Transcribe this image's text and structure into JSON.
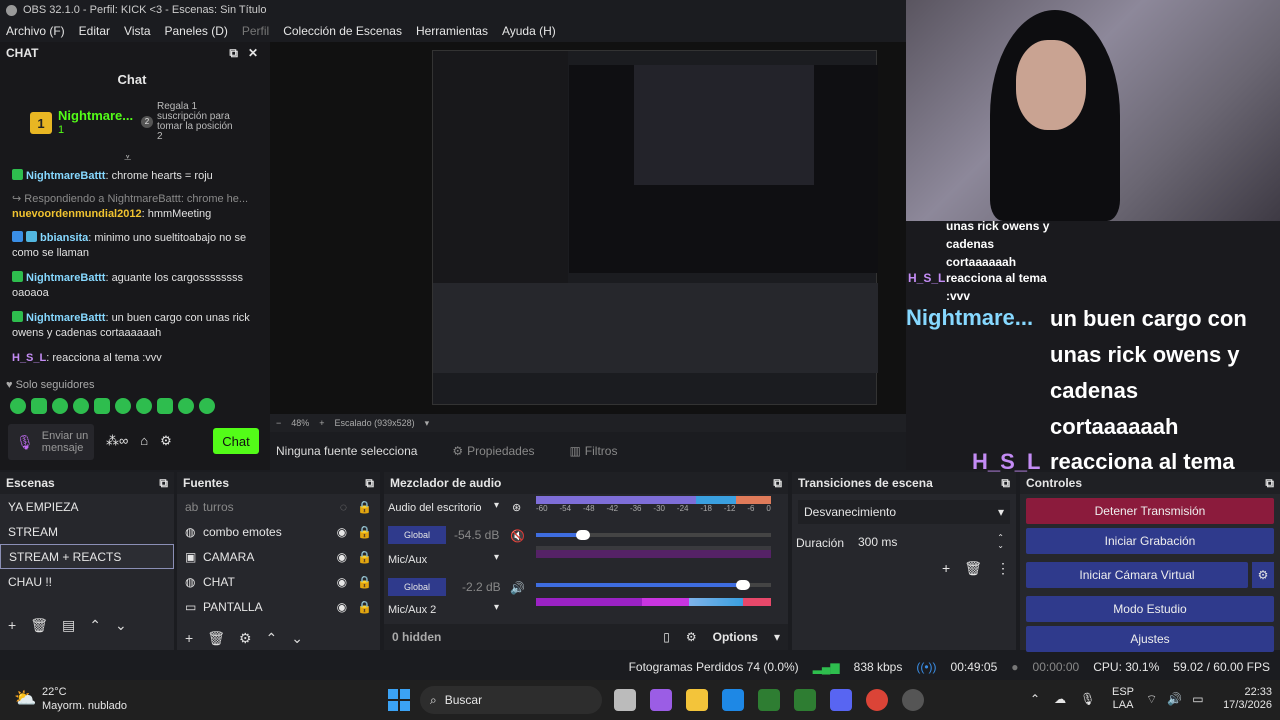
{
  "window": {
    "title": "OBS 32.1.0 - Perfil: KICK <3 - Escenas: Sin Título"
  },
  "menu": {
    "items": [
      "Archivo (F)",
      "Editar",
      "Vista",
      "Paneles (D)",
      "Perfil",
      "Colección de Escenas",
      "Herramientas",
      "Ayuda (H)"
    ]
  },
  "chat": {
    "panel_title": "CHAT",
    "title": "Chat",
    "pinned": {
      "rank": "1",
      "name": "Nightmare...",
      "count": "1",
      "gift_text": "Regala 1 suscripción para tomar la posición 2",
      "gift_rank": "2"
    },
    "messages": [
      {
        "name": "NightmareBattt",
        "text": ": chrome hearts = roju"
      },
      {
        "reply": "Respondiendo a NightmareBattt: chrome he...",
        "name": "nuevoordenmundial2012",
        "text": ": hmmMeeting"
      },
      {
        "name": "bbiansita",
        "text": ": minimo uno sueltitoabajo no se como se llaman"
      },
      {
        "name": "NightmareBattt",
        "text": ": aguante los cargossssssss oaoaoa"
      },
      {
        "name": "NightmareBattt",
        "text": ": un buen cargo con unas rick owens y cadenas cortaaaaaah"
      },
      {
        "name": "H_S_L",
        "text": ": reacciona al tema :vvv"
      }
    ],
    "followers_only": "Solo seguidores",
    "send_placeholder": "Enviar un mensaje",
    "chat_button": "Chat"
  },
  "overlay": {
    "lines_top": [
      "unas rick owens y",
      "cadenas",
      "cortaaaaaah"
    ],
    "hsl_small": "H_S_L",
    "hsl_small_text": "reacciona al tema",
    "hsl_small_text2": ":vvv",
    "name_big": "Nightmare...",
    "big_lines": [
      "un buen cargo con",
      "unas rick owens y",
      "cadenas",
      "cortaaaaaah"
    ],
    "hsl_big": "H_S_L",
    "hsl_big_text": "reacciona al tema",
    "hsl_big_text2": ":vvv"
  },
  "preview": {
    "zoom": "48%",
    "scale": "Escalado (939x528)"
  },
  "source_bar": {
    "no_source": "Ninguna fuente selecciona",
    "properties": "Propiedades",
    "filters": "Filtros"
  },
  "scenes": {
    "title": "Escenas",
    "items": [
      "YA EMPIEZA",
      "STREAM",
      "STREAM + REACTS",
      "CHAU !!"
    ],
    "selected": "STREAM + REACTS"
  },
  "sources": {
    "title": "Fuentes",
    "items": [
      "turros",
      "combo emotes",
      "CAMARA",
      "CHAT",
      "PANTALLA"
    ]
  },
  "mixer": {
    "title": "Mezclador de audio",
    "channels": [
      {
        "name": "Audio del escritorio",
        "tag": "Global",
        "db": "-54.5 dB",
        "level": 0.2
      },
      {
        "name": "Mic/Aux",
        "tag": "Global",
        "db": "-2.2 dB",
        "level": 0.88
      },
      {
        "name": "Mic/Aux 2"
      }
    ],
    "scale": [
      "-60",
      "-54",
      "-48",
      "-42",
      "-36",
      "-30",
      "-24",
      "-18",
      "-12",
      "-6",
      "0"
    ],
    "hidden": "0 hidden",
    "options": "Options"
  },
  "transitions": {
    "title": "Transiciones de escena",
    "selected": "Desvanecimiento",
    "duration_label": "Duración",
    "duration_value": "300 ms"
  },
  "controls": {
    "title": "Controles",
    "stop": "Detener Transmisión",
    "record": "Iniciar Grabación",
    "virtualcam": "Iniciar Cámara Virtual",
    "studio": "Modo Estudio",
    "settings": "Ajustes"
  },
  "status": {
    "dropped": "Fotogramas Perdidos 74 (0.0%)",
    "kbps": "838 kbps",
    "live_time": "00:49:05",
    "rec_time": "00:00:00",
    "cpu": "CPU: 30.1%",
    "fps": "59.02 / 60.00 FPS"
  },
  "taskbar": {
    "temp": "22°C",
    "weather": "Mayorm. nublado",
    "search": "Buscar",
    "lang1": "ESP",
    "lang2": "LAA",
    "time": "22:33",
    "date": "17/3/2026"
  },
  "colors": {
    "accent": "#53fc18",
    "stop_button": "#8b1b3c",
    "button": "#2f3a8c"
  }
}
